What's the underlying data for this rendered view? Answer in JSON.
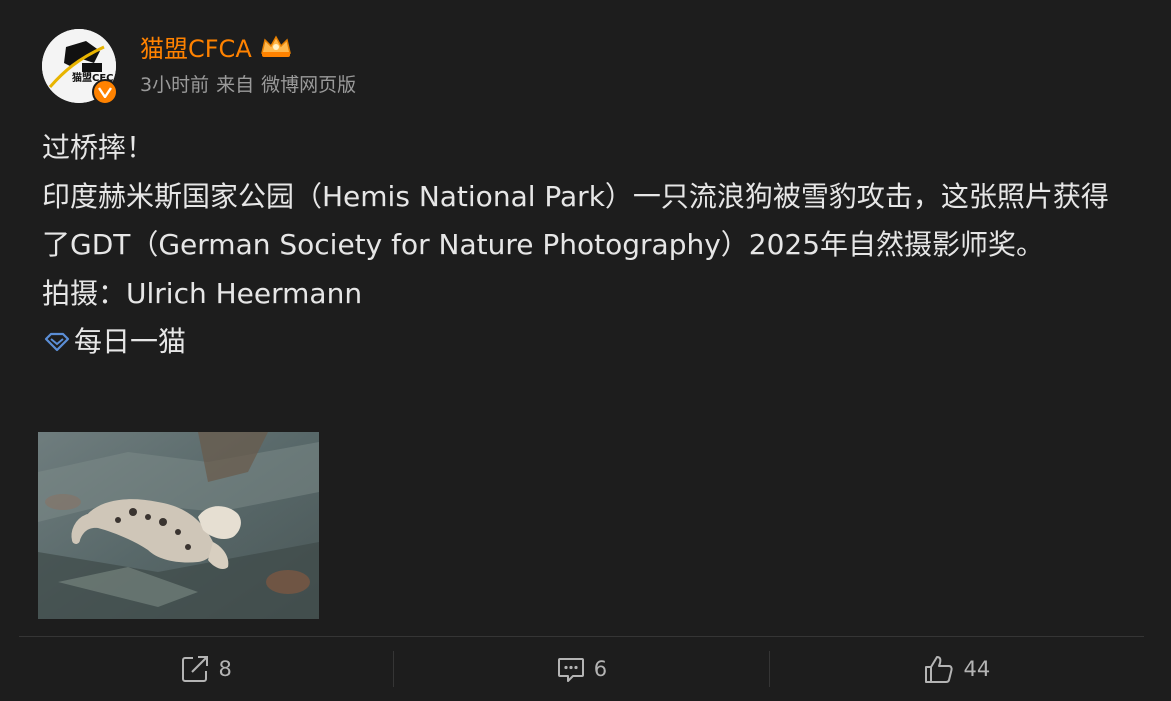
{
  "post": {
    "author": {
      "name": "猫盟CFCA",
      "avatar_text": "猫盟CFCA",
      "verified_icon": "verified-v-badge",
      "vip_icon": "crown-icon"
    },
    "meta": {
      "time": "3小时前",
      "source_prefix": "来自",
      "source": "微博网页版"
    },
    "content": {
      "lines": [
        "过桥摔！",
        "印度赫米斯国家公园（Hemis National Park）一只流浪狗被雪豹攻击，这张照片获得了GDT（German Society for Nature Photography）2025年自然摄影师奖。",
        "拍摄：Ulrich Heermann"
      ],
      "topic": "每日一猫",
      "topic_icon": "diamond-icon"
    },
    "image_icon": "snow-leopard-photo",
    "actions": {
      "repost": {
        "icon": "repost-icon",
        "count": "8"
      },
      "comment": {
        "icon": "comment-icon",
        "count": "6"
      },
      "like": {
        "icon": "thumbs-up-icon",
        "count": "44"
      }
    },
    "colors": {
      "background": "#1d1d1d",
      "author_name": "#ff8200",
      "text": "#e6e6e6",
      "meta": "#9a9a9a",
      "topic_icon": "#5b8ed6"
    }
  }
}
